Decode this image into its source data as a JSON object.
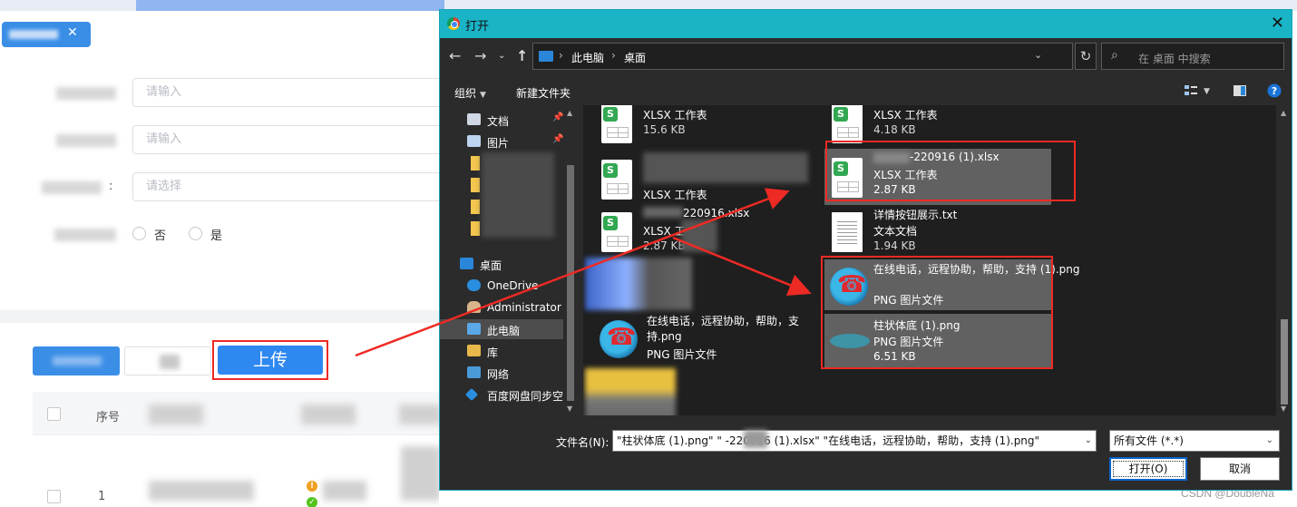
{
  "form": {
    "placeholder_input_1": "请输入",
    "placeholder_input_2": "请输入",
    "placeholder_select": "请选择",
    "colon": ":",
    "radio_no": "否",
    "radio_yes": "是"
  },
  "toolbar": {
    "upload_label": "上传"
  },
  "table": {
    "col_index": "序号",
    "row1_index": "1"
  },
  "dialog": {
    "title": "打开",
    "close": "✕",
    "breadcrumb": [
      "此电脑",
      "桌面"
    ],
    "search_placeholder": "在 桌面 中搜索",
    "organize": "组织",
    "new_folder": "新建文件夹",
    "nav_items": [
      {
        "label": "文档",
        "pinned": true
      },
      {
        "label": "图片",
        "pinned": true
      },
      {
        "label": "桌面"
      },
      {
        "label": "OneDrive"
      },
      {
        "label": "Administrator"
      },
      {
        "label": "此电脑"
      },
      {
        "label": "库"
      },
      {
        "label": "网络"
      },
      {
        "label": "百度网盘同步空"
      }
    ],
    "files": [
      {
        "name": "",
        "type": "XLSX 工作表",
        "size": "15.6 KB"
      },
      {
        "name": "",
        "type": "XLSX 工作表",
        "size": "4.18 KB"
      },
      {
        "name": "",
        "type": "XLSX 工作表",
        "size": ""
      },
      {
        "name": "-220916 (1).xlsx",
        "type": "XLSX 工作表",
        "size": "2.87 KB"
      },
      {
        "name": "220916.xlsx",
        "type": "XLSX 工作表",
        "size": "2.87 KB"
      },
      {
        "name": "详情按钮展示.txt",
        "type": "文本文档",
        "size": "1.94 KB"
      },
      {
        "name": "在线电话，远程协助，帮助，支持 (1).png",
        "type": "PNG 图片文件",
        "size": ""
      },
      {
        "name": "在线电话，远程协助，帮助，支持.png",
        "type": "PNG 图片文件",
        "size": ""
      },
      {
        "name": "柱状体底 (1).png",
        "type": "PNG 图片文件",
        "size": "6.51 KB"
      }
    ],
    "filename_label": "文件名(N):",
    "filename_value": "\"柱状体底 (1).png\" \"      -220916 (1).xlsx\" \"在线电话，远程协助，帮助，支持 (1).png\"",
    "filetype_value": "所有文件 (*.*)",
    "open_label": "打开(O)",
    "cancel_label": "取消"
  },
  "watermark": "CSDN @DoubleNa",
  "colors": {
    "primary_blue": "#2e88f0",
    "annotation_red": "#ee2a24",
    "title_teal": "#1ab4c7",
    "dialog_dark": "#2b2b2b"
  },
  "icons": [
    "chrome-icon",
    "close-icon",
    "back-arrow-icon",
    "forward-arrow-icon",
    "up-arrow-icon",
    "refresh-icon",
    "search-icon",
    "view-icon",
    "help-icon",
    "pin-icon",
    "xlsx-file-icon",
    "txt-file-icon",
    "png-file-icon"
  ]
}
